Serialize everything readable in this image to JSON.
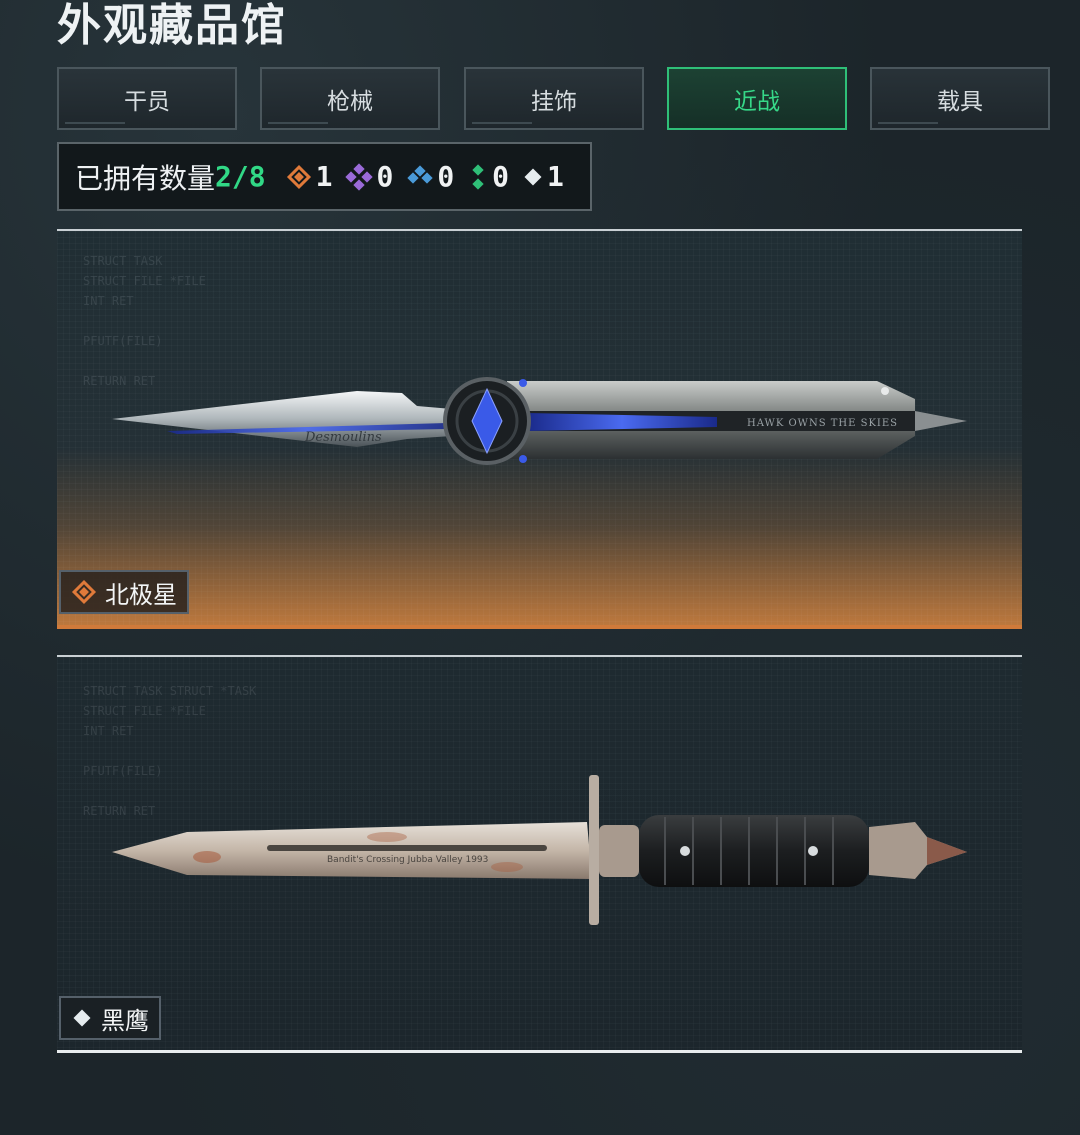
{
  "page_title": "外观藏品馆",
  "tabs": [
    {
      "label": "干员",
      "active": false
    },
    {
      "label": "枪械",
      "active": false
    },
    {
      "label": "挂饰",
      "active": false
    },
    {
      "label": "近战",
      "active": true
    },
    {
      "label": "载具",
      "active": false
    }
  ],
  "owned": {
    "label": "已拥有数量",
    "count": "2/8",
    "rarities": [
      {
        "icon": "orange-diamond-icon",
        "color": "#e07a3a",
        "value": "1"
      },
      {
        "icon": "purple-diamond-icon",
        "color": "#9a6ad8",
        "value": "0"
      },
      {
        "icon": "blue-diamond-icon",
        "color": "#4a9ad8",
        "value": "0"
      },
      {
        "icon": "green-diamond-icon",
        "color": "#2fbf78",
        "value": "0"
      },
      {
        "icon": "white-diamond-icon",
        "color": "#e6ecef",
        "value": "1"
      }
    ]
  },
  "items": [
    {
      "name": "北极星",
      "rarity_icon": "orange-diamond-icon",
      "rarity_color": "#e07a3a",
      "engraving_blade": "Desmoulins",
      "engraving_handle": "HAWK OWNS THE SKIES"
    },
    {
      "name": "黑鹰",
      "rarity_icon": "white-diamond-icon",
      "rarity_color": "#e6ecef",
      "engraving_blade": "Bandit's Crossing Jubba Valley 1993"
    }
  ],
  "background_text": {
    "lines_left": [
      "STRUCT TASK STRUCT *TASK",
      "STRUCT FILE *FILE",
      "INT RET",
      "",
      "PFUTF(FILE)",
      "",
      "RETURN RET"
    ]
  }
}
